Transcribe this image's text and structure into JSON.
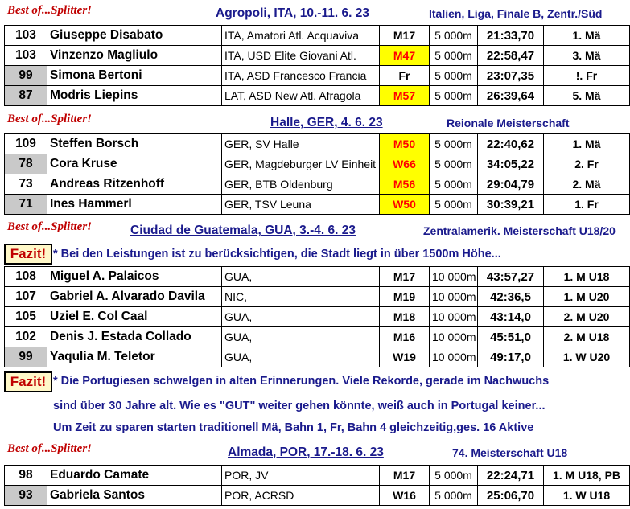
{
  "colors": {
    "title_blue": "#1a1a8c",
    "best_red": "#c00000",
    "highlight_yellow": "#ffff00",
    "highlight_text_red": "#ff0000",
    "bib_gray": "#c9c9c9"
  },
  "sections": [
    {
      "best_of": "Best of...Splitter!",
      "title": "Agropoli, ITA,  10.-11. 6. 23",
      "info": "Italien, Liga, Finale B, Zentr./Süd",
      "rows": [
        {
          "bib": "103",
          "name": "Giuseppe Disabato",
          "club": "ITA, Amatori Atl. Acquaviva",
          "cat": "M17",
          "dist": "5 000m",
          "time": "21:33,70",
          "place": "1. Mä"
        },
        {
          "bib": "103",
          "name": "Vinzenzo Magliulo",
          "club": "ITA, USD Elite Giovani Atl.",
          "cat": "M47",
          "dist": "5 000m",
          "time": "22:58,47",
          "place": "3. Mä"
        },
        {
          "bib": "99",
          "name": "Simona Bertoni",
          "club": "ITA, ASD Francesco Francia",
          "cat": "Fr",
          "dist": "5 000m",
          "time": "23:07,35",
          "place": "!. Fr"
        },
        {
          "bib": "87",
          "name": "Modris Liepins",
          "club": "LAT, ASD New Atl. Afragola",
          "cat": "M57",
          "dist": "5 000m",
          "time": "26:39,64",
          "place": "5. Mä"
        }
      ]
    },
    {
      "best_of": "Best of...Splitter!",
      "title": "Halle, GER,  4. 6. 23",
      "info": "Reionale Meisterschaft",
      "rows": [
        {
          "bib": "109",
          "name": "Steffen Borsch",
          "club": "GER, SV Halle",
          "cat": "M50",
          "dist": "5 000m",
          "time": "22:40,62",
          "place": "1. Mä"
        },
        {
          "bib": "78",
          "name": "Cora Kruse",
          "club": "GER, Magdeburger LV Einheit",
          "cat": "W66",
          "dist": "5 000m",
          "time": "34:05,22",
          "place": "2. Fr"
        },
        {
          "bib": "73",
          "name": "Andreas Ritzenhoff",
          "club": "GER, BTB Oldenburg",
          "cat": "M56",
          "dist": "5 000m",
          "time": "29:04,79",
          "place": "2. Mä"
        },
        {
          "bib": "71",
          "name": "Ines Hammerl",
          "club": "GER, TSV Leuna",
          "cat": "W50",
          "dist": "5 000m",
          "time": "30:39,21",
          "place": "1. Fr"
        }
      ]
    },
    {
      "best_of": "Best of...Splitter!",
      "title": "Ciudad de Guatemala, GUA,  3.-4. 6. 23",
      "info": "Zentralamerik. Meisterschaft U18/20",
      "fazit": "Fazit!",
      "note": "* Bei den Leistungen ist zu berücksichtigen, die Stadt liegt in über 1500m Höhe...",
      "rows": [
        {
          "bib": "108",
          "name": "Miguel A. Palaicos",
          "club": "GUA,",
          "cat": "M17",
          "dist": "10 000m",
          "time": "43:57,27",
          "place": "1. M U18"
        },
        {
          "bib": "107",
          "name": "Gabriel A. Alvarado Davila",
          "club": "NIC,",
          "cat": "M19",
          "dist": "10 000m",
          "time": "42:36,5",
          "place": "1. M U20"
        },
        {
          "bib": "105",
          "name": "Uziel E. Col Caal",
          "club": "GUA,",
          "cat": "M18",
          "dist": "10 000m",
          "time": "43:14,0",
          "place": "2. M U20"
        },
        {
          "bib": "102",
          "name": "Denis J. Estada Collado",
          "club": "GUA,",
          "cat": "M16",
          "dist": "10 000m",
          "time": "45:51,0",
          "place": "2. M U18"
        },
        {
          "bib": "99",
          "name": "Yaqulia M. Teletor",
          "club": "GUA,",
          "cat": "W19",
          "dist": "10 000m",
          "time": "49:17,0",
          "place": "1. W U20"
        }
      ]
    },
    {
      "fazit": "Fazit!",
      "note_lines": [
        "* Die Portugiesen schwelgen in alten Erinnerungen. Viele Rekorde, gerade im Nachwuchs",
        "sind über 30 Jahre alt. Wie es \"GUT\" weiter gehen könnte, weiß auch in Portugal keiner...",
        "Um Zeit zu sparen starten traditionell Mä, Bahn 1, Fr, Bahn 4 gleichzeitig,ges. 16 Aktive"
      ]
    },
    {
      "best_of": "Best of...Splitter!",
      "title": "Almada, POR,  17.-18. 6. 23",
      "info": "74. Meisterschaft U18",
      "rows": [
        {
          "bib": "98",
          "name": "Eduardo Camate",
          "club": "POR, JV",
          "cat": "M17",
          "dist": "5 000m",
          "time": "22:24,71",
          "place": "1. M U18, PB"
        },
        {
          "bib": "93",
          "name": "Gabriela Santos",
          "club": "POR, ACRSD",
          "cat": "W16",
          "dist": "5 000m",
          "time": "25:06,70",
          "place": "1. W U18"
        }
      ]
    }
  ]
}
